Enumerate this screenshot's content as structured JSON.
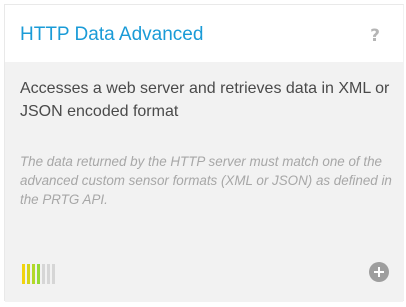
{
  "card": {
    "title": "HTTP Data Advanced",
    "help_icon": "help-icon",
    "help_glyph": "?",
    "description": "Accesses a web server and retrieves data in XML or JSON encoded format",
    "note": "The data returned by the HTTP server must match one of the advanced custom sensor formats (XML or JSON) as defined in the PRTG API.",
    "performance_impact": {
      "level": 4,
      "max": 7,
      "colors": [
        "#f2d40e",
        "#d3d61b",
        "#b4d828",
        "#96da35"
      ],
      "inactive_color": "#d6d6d6"
    },
    "add_icon": "add-circle-icon"
  }
}
